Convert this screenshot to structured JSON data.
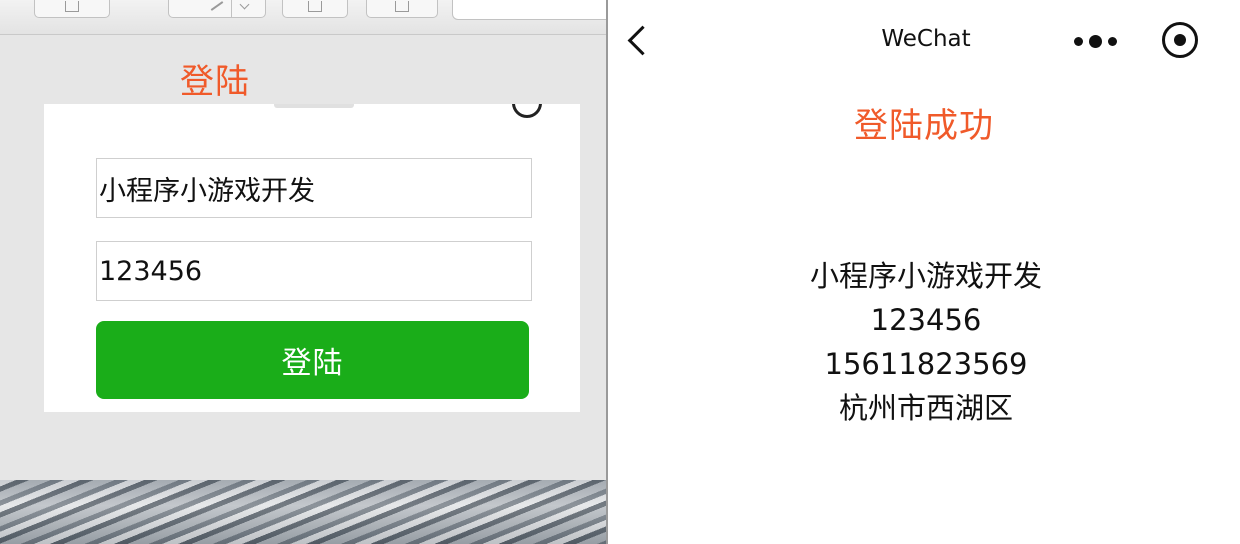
{
  "editor": {
    "heading": "登陆"
  },
  "login_form": {
    "username_value": "小程序小游戏开发",
    "password_value": "123456",
    "login_button_label": "登陆"
  },
  "wechat": {
    "nav": {
      "title": "WeChat",
      "back_icon": "chevron-left-icon",
      "more_icon": "more-dots-icon",
      "close_icon": "target-circle-icon"
    },
    "success_heading": "登陆成功",
    "info": {
      "username": "小程序小游戏开发",
      "password": "123456",
      "phone": "15611823569",
      "address": "杭州市西湖区"
    }
  },
  "colors": {
    "accent_red": "#f05a2a",
    "button_green": "#1aad19"
  }
}
